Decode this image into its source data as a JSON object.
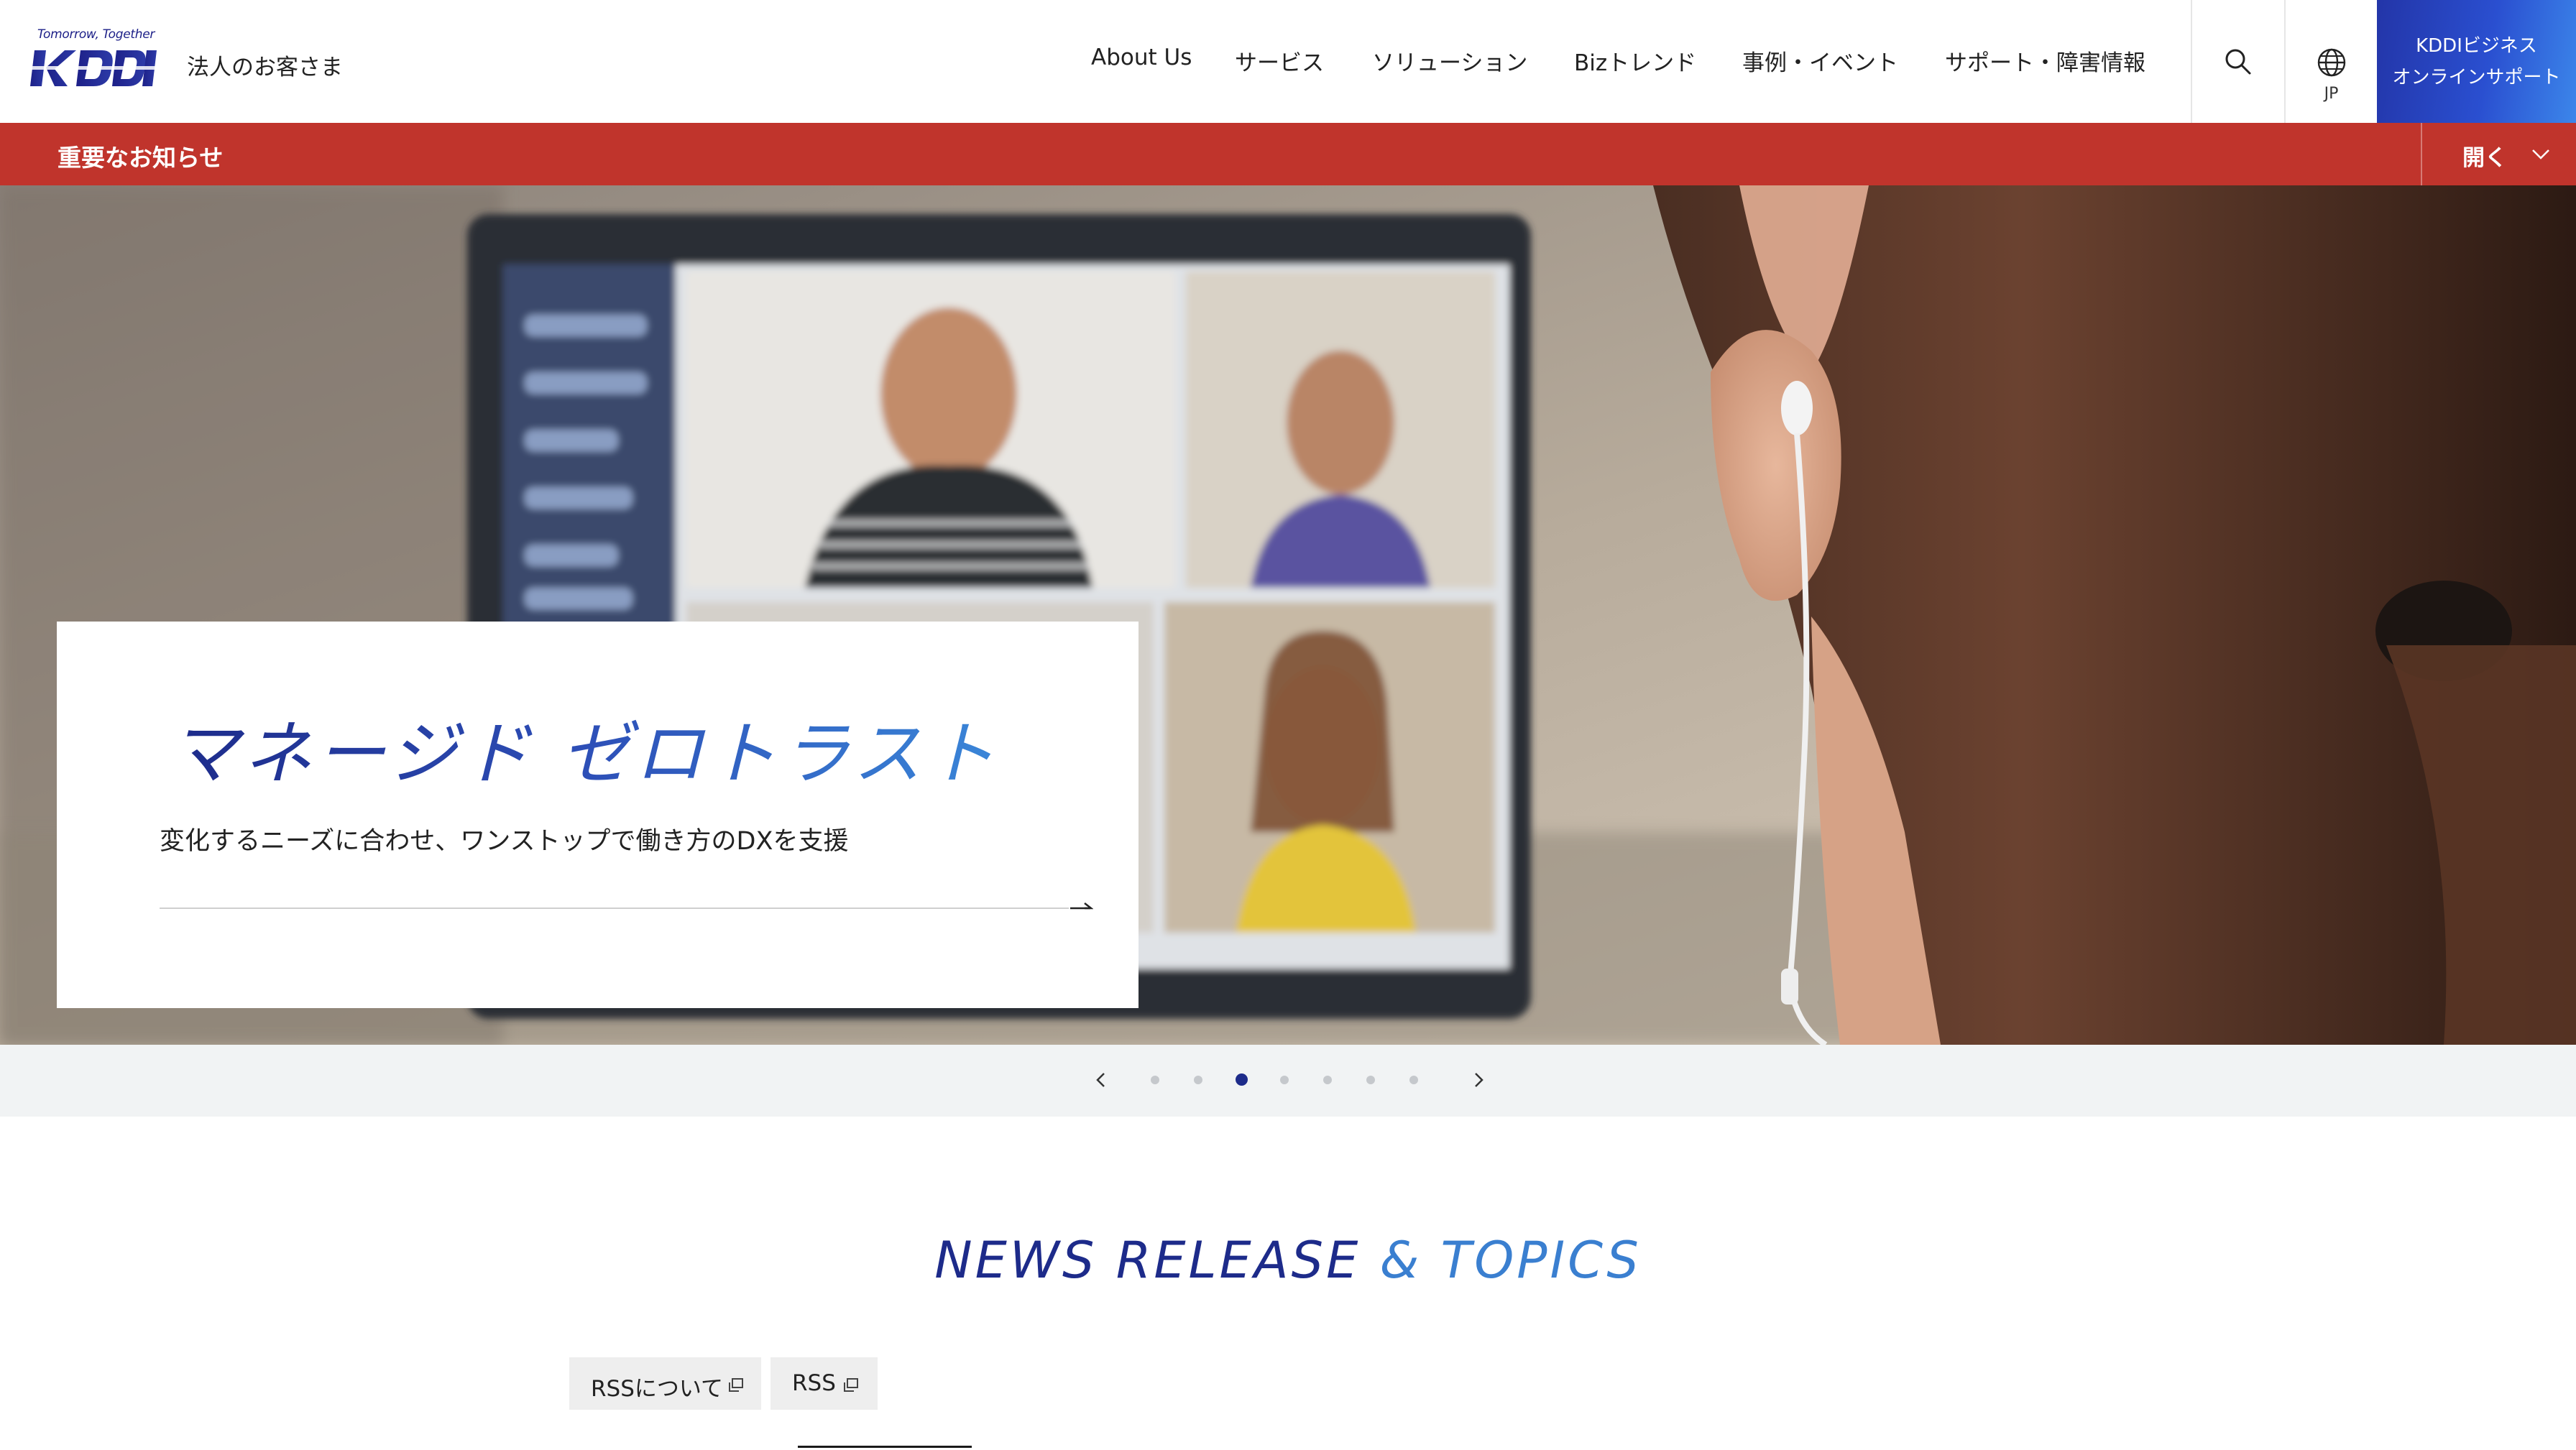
{
  "header": {
    "logo_tagline": "Tomorrow, Together",
    "logo_text": "KDDI",
    "corp_label": "法人のお客さま",
    "nav": [
      {
        "label": "About Us",
        "name": "nav-about-us"
      },
      {
        "label": "サービス",
        "name": "nav-services"
      },
      {
        "label": "ソリューション",
        "name": "nav-solutions"
      },
      {
        "label": "Bizトレンド",
        "name": "nav-biz-trend"
      },
      {
        "label": "事例・イベント",
        "name": "nav-cases-events"
      },
      {
        "label": "サポート・障害情報",
        "name": "nav-support"
      }
    ],
    "search_icon": "search-icon",
    "language_icon": "globe-icon",
    "language_label": "JP",
    "online_support_line1": "KDDIビジネス",
    "online_support_line2": "オンラインサポート"
  },
  "notice": {
    "title": "重要なお知らせ",
    "toggle_label": "開く",
    "toggle_icon": "chevron-down-icon"
  },
  "hero": {
    "title": "マネージド ゼロトラスト",
    "subtitle": "変化するニーズに合わせ、ワンストップで働き方のDXを支援",
    "link_icon": "arrow-right-icon"
  },
  "carousel": {
    "prev_icon": "chevron-left-icon",
    "next_icon": "chevron-right-icon",
    "slide_count": 7,
    "active_index": 2
  },
  "news": {
    "title_part1": "NEWS RELEASE",
    "title_part2": "& TOPICS",
    "chips": [
      {
        "label": "RSSについて",
        "icon": "external-link-icon"
      },
      {
        "label": "RSS",
        "icon": "external-link-icon"
      }
    ]
  },
  "colors": {
    "brand_navy": "#1d2088",
    "notice_red": "#c0342c",
    "accent_blue": "#3a7fd0"
  }
}
